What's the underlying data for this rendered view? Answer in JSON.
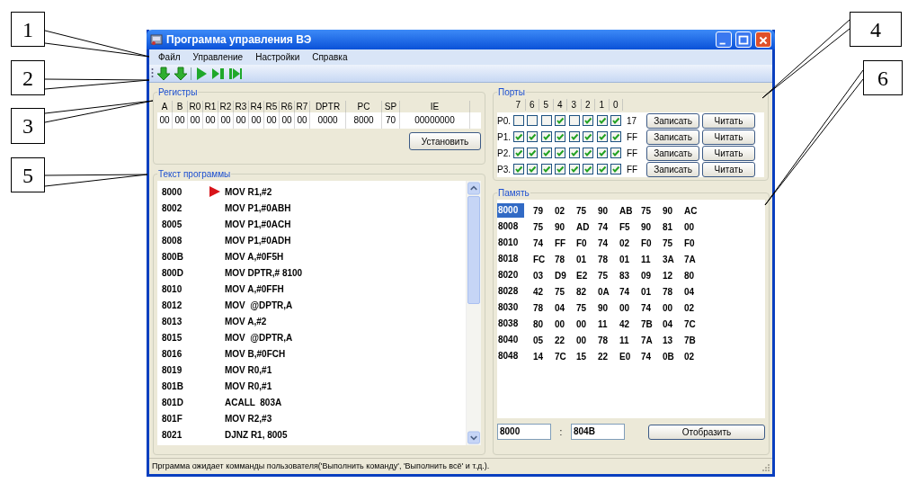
{
  "callouts": [
    {
      "label": "1"
    },
    {
      "label": "2"
    },
    {
      "label": "3"
    },
    {
      "label": "5"
    },
    {
      "label": "4"
    },
    {
      "label": "6"
    }
  ],
  "window": {
    "title": "Программа управления ВЭ"
  },
  "menu": [
    "Файл",
    "Управление",
    "Настройки",
    "Справка"
  ],
  "registers": {
    "title": "Регистры",
    "columns": [
      {
        "name": "A",
        "value": "00"
      },
      {
        "name": "B",
        "value": "00"
      },
      {
        "name": "R0",
        "value": "00"
      },
      {
        "name": "R1",
        "value": "00"
      },
      {
        "name": "R2",
        "value": "00"
      },
      {
        "name": "R3",
        "value": "00"
      },
      {
        "name": "R4",
        "value": "00"
      },
      {
        "name": "R5",
        "value": "00"
      },
      {
        "name": "R6",
        "value": "00"
      },
      {
        "name": "R7",
        "value": "00"
      },
      {
        "name": "DPTR",
        "value": "0000"
      },
      {
        "name": "PC",
        "value": "8000"
      },
      {
        "name": "SP",
        "value": "70"
      },
      {
        "name": "IE",
        "value": "00000000"
      }
    ],
    "button": "Установить"
  },
  "program": {
    "title": "Текст программы",
    "rows": [
      {
        "address": "8000",
        "instruction": "MOV R1,#2",
        "current": true
      },
      {
        "address": "8002",
        "instruction": "MOV P1,#0ABH",
        "current": false
      },
      {
        "address": "8005",
        "instruction": "MOV P1,#0ACH",
        "current": false
      },
      {
        "address": "8008",
        "instruction": "MOV P1,#0ADH",
        "current": false
      },
      {
        "address": "800B",
        "instruction": "MOV A,#0F5H",
        "current": false
      },
      {
        "address": "800D",
        "instruction": "MOV DPTR,# 8100",
        "current": false
      },
      {
        "address": "8010",
        "instruction": "MOV A,#0FFH",
        "current": false
      },
      {
        "address": "8012",
        "instruction": "MOV  @DPTR,A",
        "current": false
      },
      {
        "address": "8013",
        "instruction": "MOV A,#2",
        "current": false
      },
      {
        "address": "8015",
        "instruction": "MOV  @DPTR,A",
        "current": false
      },
      {
        "address": "8016",
        "instruction": "MOV B,#0FCH",
        "current": false
      },
      {
        "address": "8019",
        "instruction": "MOV R0,#1",
        "current": false
      },
      {
        "address": "801B",
        "instruction": "MOV R0,#1",
        "current": false
      },
      {
        "address": "801D",
        "instruction": "ACALL  803A",
        "current": false
      },
      {
        "address": "801F",
        "instruction": "MOV R2,#3",
        "current": false
      },
      {
        "address": "8021",
        "instruction": "DJNZ R1, 8005",
        "current": false
      }
    ]
  },
  "ports": {
    "title": "Порты",
    "bit_labels": [
      "7",
      "6",
      "5",
      "4",
      "3",
      "2",
      "1",
      "0"
    ],
    "rows": [
      {
        "name": "P0.",
        "bits": [
          {
            "checked": false
          },
          {
            "checked": false
          },
          {
            "checked": false
          },
          {
            "checked": true
          },
          {
            "checked": false
          },
          {
            "checked": true
          },
          {
            "checked": true
          },
          {
            "checked": true
          }
        ],
        "value": "17",
        "write": "Записать",
        "read": "Читать"
      },
      {
        "name": "P1.",
        "bits": [
          {
            "checked": true
          },
          {
            "checked": true
          },
          {
            "checked": true
          },
          {
            "checked": true
          },
          {
            "checked": true
          },
          {
            "checked": true
          },
          {
            "checked": true
          },
          {
            "checked": true
          }
        ],
        "value": "FF",
        "write": "Записать",
        "read": "Читать"
      },
      {
        "name": "P2.",
        "bits": [
          {
            "checked": true
          },
          {
            "checked": true
          },
          {
            "checked": true
          },
          {
            "checked": true
          },
          {
            "checked": true
          },
          {
            "checked": true
          },
          {
            "checked": true
          },
          {
            "checked": true
          }
        ],
        "value": "FF",
        "write": "Записать",
        "read": "Читать"
      },
      {
        "name": "P3.",
        "bits": [
          {
            "checked": true
          },
          {
            "checked": true
          },
          {
            "checked": true
          },
          {
            "checked": true
          },
          {
            "checked": true
          },
          {
            "checked": true
          },
          {
            "checked": true
          },
          {
            "checked": true
          }
        ],
        "value": "FF",
        "write": "Записать",
        "read": "Читать"
      }
    ]
  },
  "memory": {
    "title": "Память",
    "rows": [
      {
        "address": "8000",
        "selected": true,
        "bytes": [
          "79",
          "02",
          "75",
          "90",
          "AB",
          "75",
          "90",
          "AC"
        ]
      },
      {
        "address": "8008",
        "selected": false,
        "bytes": [
          "75",
          "90",
          "AD",
          "74",
          "F5",
          "90",
          "81",
          "00"
        ]
      },
      {
        "address": "8010",
        "selected": false,
        "bytes": [
          "74",
          "FF",
          "F0",
          "74",
          "02",
          "F0",
          "75",
          "F0"
        ]
      },
      {
        "address": "8018",
        "selected": false,
        "bytes": [
          "FC",
          "78",
          "01",
          "78",
          "01",
          "11",
          "3A",
          "7A"
        ]
      },
      {
        "address": "8020",
        "selected": false,
        "bytes": [
          "03",
          "D9",
          "E2",
          "75",
          "83",
          "09",
          "12",
          "80"
        ]
      },
      {
        "address": "8028",
        "selected": false,
        "bytes": [
          "42",
          "75",
          "82",
          "0A",
          "74",
          "01",
          "78",
          "04"
        ]
      },
      {
        "address": "8030",
        "selected": false,
        "bytes": [
          "78",
          "04",
          "75",
          "90",
          "00",
          "74",
          "00",
          "02"
        ]
      },
      {
        "address": "8038",
        "selected": false,
        "bytes": [
          "80",
          "00",
          "00",
          "11",
          "42",
          "7B",
          "04",
          "7C"
        ]
      },
      {
        "address": "8040",
        "selected": false,
        "bytes": [
          "05",
          "22",
          "00",
          "78",
          "11",
          "7A",
          "13",
          "7B"
        ]
      },
      {
        "address": "8048",
        "selected": false,
        "bytes": [
          "14",
          "7C",
          "15",
          "22",
          "E0",
          "74",
          "0B",
          "02"
        ]
      }
    ],
    "from": "8000",
    "separator": ":",
    "to": "804B",
    "button": "Отобразить"
  },
  "status_bar": "Прграмма ожидает комманды пользователя('Выполнить команду', 'Выполнить всё' и т.д.)."
}
